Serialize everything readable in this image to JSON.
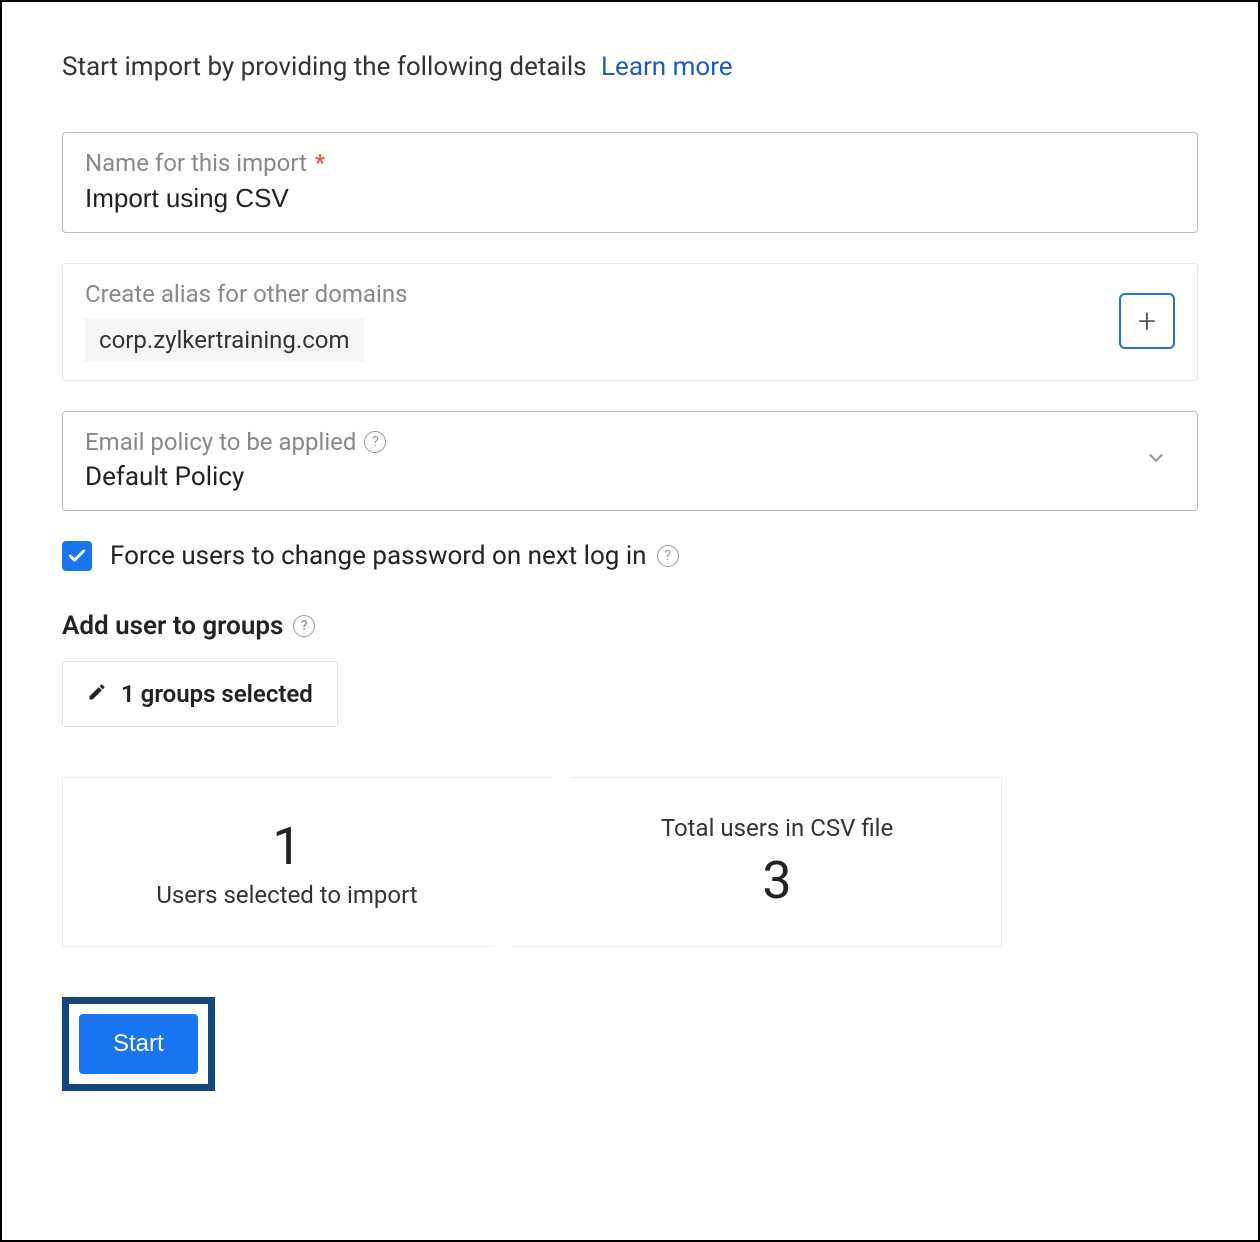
{
  "header": {
    "intro_text": "Start import by providing the following details",
    "learn_more_label": "Learn more"
  },
  "import_name": {
    "label": "Name for this import",
    "required_marker": "*",
    "value": "Import using CSV"
  },
  "alias": {
    "label": "Create alias for other domains",
    "domain": "corp.zylkertraining.com",
    "add_icon_glyph": "+"
  },
  "policy": {
    "label": "Email policy to be applied",
    "value": "Default Policy"
  },
  "force_password": {
    "checked": true,
    "label": "Force users to change password on next log in"
  },
  "groups": {
    "heading": "Add user to groups",
    "button_label": "1 groups selected"
  },
  "stats": {
    "selected": {
      "number": "1",
      "label": "Users selected to import"
    },
    "total": {
      "number": "3",
      "label": "Total users in CSV file"
    }
  },
  "actions": {
    "start_label": "Start"
  },
  "help_glyph": "?"
}
